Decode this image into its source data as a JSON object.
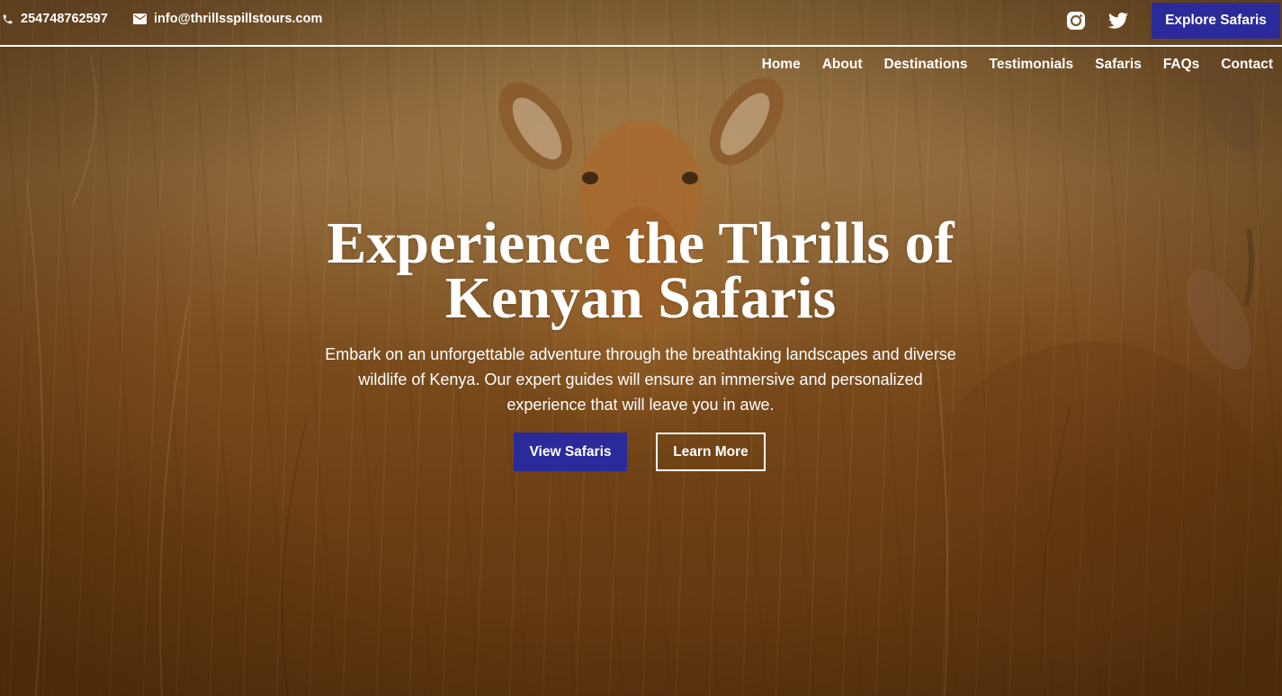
{
  "topbar": {
    "phone": "254748762597",
    "email": "info@thrillsspillstours.com",
    "explore_label": "Explore Safaris",
    "phone_icon": "phone-icon",
    "email_icon": "mail-icon",
    "instagram_icon": "instagram-icon",
    "twitter_icon": "twitter-icon"
  },
  "nav": {
    "items": [
      "Home",
      "About",
      "Destinations",
      "Testimonials",
      "Safaris",
      "FAQs",
      "Contact"
    ]
  },
  "hero": {
    "title_line1": "Experience the Thrills of",
    "title_line2": "Kenyan Safaris",
    "subtitle": "Embark on an unforgettable adventure through the breathtaking landscapes and diverse wildlife of Kenya. Our expert guides will ensure an immersive and personalized experience that will leave you in awe.",
    "primary_button": "View Safaris",
    "secondary_button": "Learn More"
  },
  "colors": {
    "accent": "#2b2a9a",
    "text": "#ffffff"
  }
}
